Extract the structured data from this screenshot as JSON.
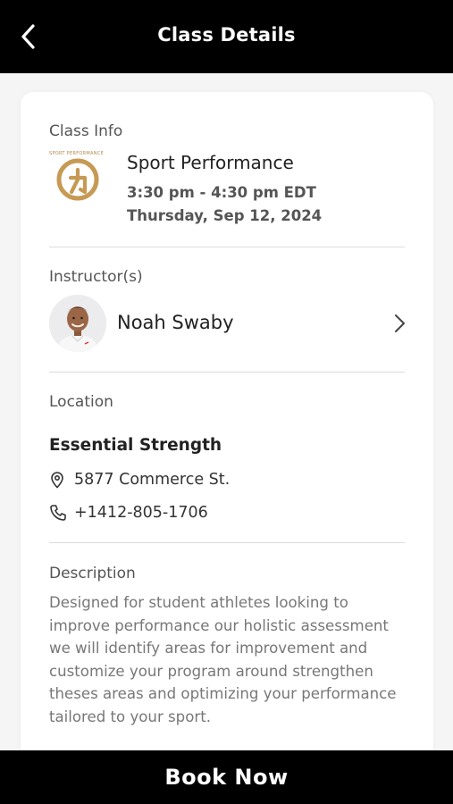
{
  "header": {
    "title": "Class Details",
    "back_icon": "chevron-left-icon"
  },
  "class_info": {
    "section_label": "Class Info",
    "logo_caption": "SPORT PERFORMANCE",
    "logo_icon": "sport-performance-logo",
    "name": "Sport Performance",
    "time": "3:30 pm - 4:30 pm EDT",
    "date": "Thursday, Sep 12, 2024"
  },
  "instructors": {
    "section_label": "Instructor(s)",
    "items": [
      {
        "name": "Noah Swaby"
      }
    ]
  },
  "location": {
    "section_label": "Location",
    "name": "Essential Strength",
    "address": "5877 Commerce St.",
    "phone": "+1412-805-1706"
  },
  "description": {
    "section_label": "Description",
    "text": "Designed for student athletes looking to improve performance our holistic assessment we will identify areas for improvement and customize your program around strengthen theses areas and optimizing your performance tailored to your sport."
  },
  "footer": {
    "book_label": "Book Now"
  },
  "colors": {
    "header_bg": "#000000",
    "accent_gold": "#c69a54",
    "card_bg": "#ffffff",
    "page_bg": "#f5f5f6"
  }
}
